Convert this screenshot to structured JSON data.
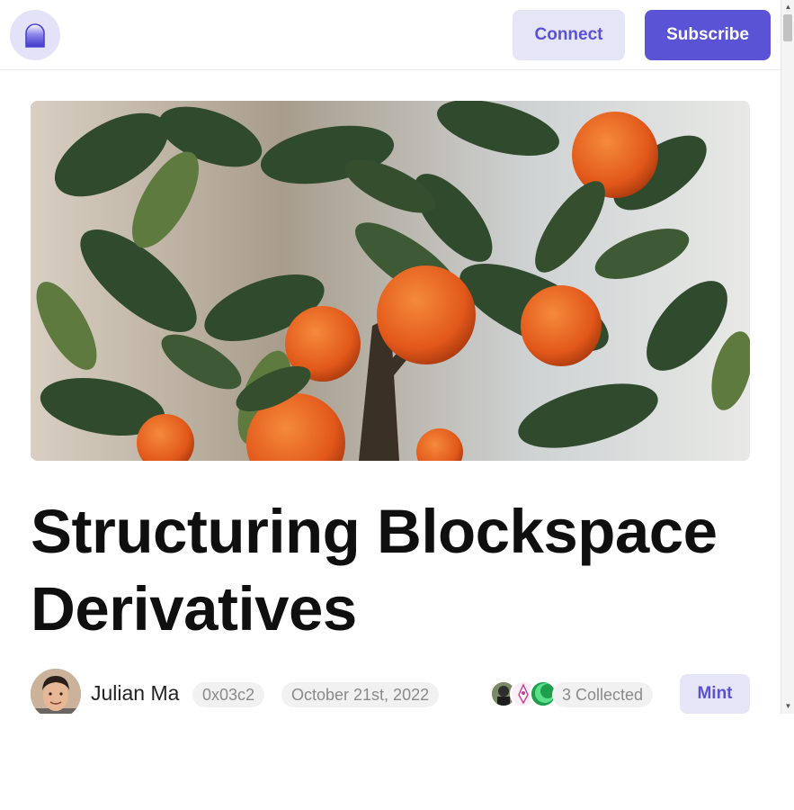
{
  "header": {
    "connect_label": "Connect",
    "subscribe_label": "Subscribe"
  },
  "article": {
    "title": "Structuring Blockspace Derivatives",
    "author_name": "Julian Ma",
    "author_address": "0x03c2",
    "date": "October 21st, 2022",
    "collected_label": "3 Collected",
    "mint_label": "Mint"
  },
  "colors": {
    "accent": "#5b53d6",
    "accent_soft": "#e6e5f8",
    "pill_bg": "#f1f1f1"
  },
  "icons": {
    "logo": "mirror-arch-logo",
    "scroll_up": "triangle-up-icon",
    "scroll_down": "triangle-down-icon"
  }
}
